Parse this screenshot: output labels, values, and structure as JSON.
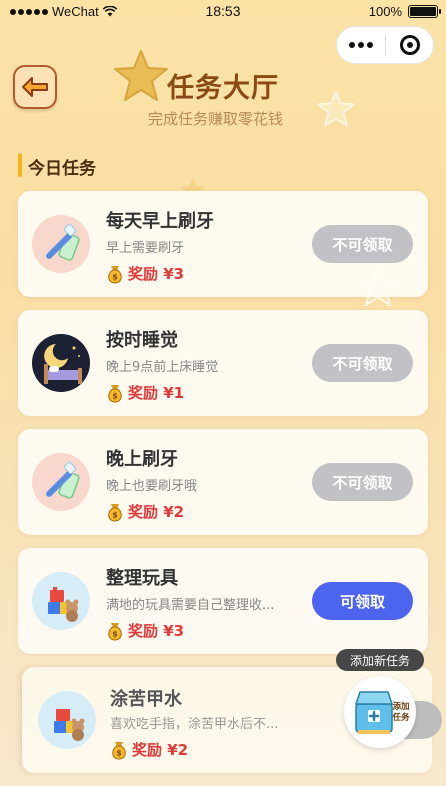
{
  "status_bar": {
    "carrier": "WeChat",
    "time": "18:53",
    "battery": "100%"
  },
  "header": {
    "title": "任务大厅",
    "subtitle": "完成任务赚取零花钱",
    "back_icon": "arrow-left-icon"
  },
  "section": {
    "title": "今日任务"
  },
  "tasks": [
    {
      "name": "每天早上刷牙",
      "desc": "早上需要刷牙",
      "reward": "奖励 ¥3",
      "button": "不可领取",
      "enabled": false,
      "icon": "toothbrush-icon"
    },
    {
      "name": "按时睡觉",
      "desc": "晚上9点前上床睡觉",
      "reward": "奖励 ¥1",
      "button": "不可领取",
      "enabled": false,
      "icon": "moon-bed-icon"
    },
    {
      "name": "晚上刷牙",
      "desc": "晚上也要刷牙哦",
      "reward": "奖励 ¥2",
      "button": "不可领取",
      "enabled": false,
      "icon": "toothbrush-icon"
    },
    {
      "name": "整理玩具",
      "desc": "满地的玩具需要自己整理收...",
      "reward": "奖励 ¥3",
      "button": "可领取",
      "enabled": true,
      "icon": "toys-icon"
    },
    {
      "name": "涂苦甲水",
      "desc": "喜欢吃手指，涂苦甲水后不...",
      "reward": "奖励 ¥2",
      "button": "",
      "enabled": false,
      "icon": "toys-icon"
    }
  ],
  "fab": {
    "tooltip": "添加新任务",
    "label_line1": "添加",
    "label_line2": "任务"
  },
  "colors": {
    "claim_enabled": "#4d64ef",
    "claim_disabled": "#c2c2c6",
    "reward": "#e03a3a",
    "title": "#8a4a13"
  }
}
